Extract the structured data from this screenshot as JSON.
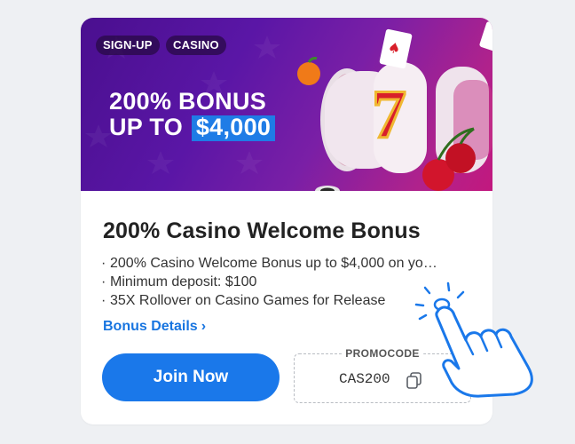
{
  "banner": {
    "tags": [
      "SIGN-UP",
      "CASINO"
    ],
    "headline_line1": "200% BONUS",
    "headline_line2_prefix": "UP TO",
    "headline_amount": "$4,000",
    "colors": {
      "bg_start": "#4a0f8f",
      "bg_end": "#c2187e",
      "amount_bg": "#1f7ce6"
    }
  },
  "offer": {
    "title": "200% Casino Welcome Bonus",
    "bullets": [
      "200% Casino Welcome Bonus up to $4,000 on yo…",
      "Minimum deposit: $100",
      "35X Rollover on Casino Games for Release"
    ],
    "details_link": "Bonus Details",
    "details_chevron": "›"
  },
  "actions": {
    "join_label": "Join Now",
    "promo_label": "PROMOCODE",
    "promo_code": "CAS200"
  },
  "icons": {
    "copy": "copy-icon",
    "hand": "pointing-hand-icon"
  },
  "colors": {
    "primary": "#1a78ea",
    "link": "#1875e0"
  }
}
